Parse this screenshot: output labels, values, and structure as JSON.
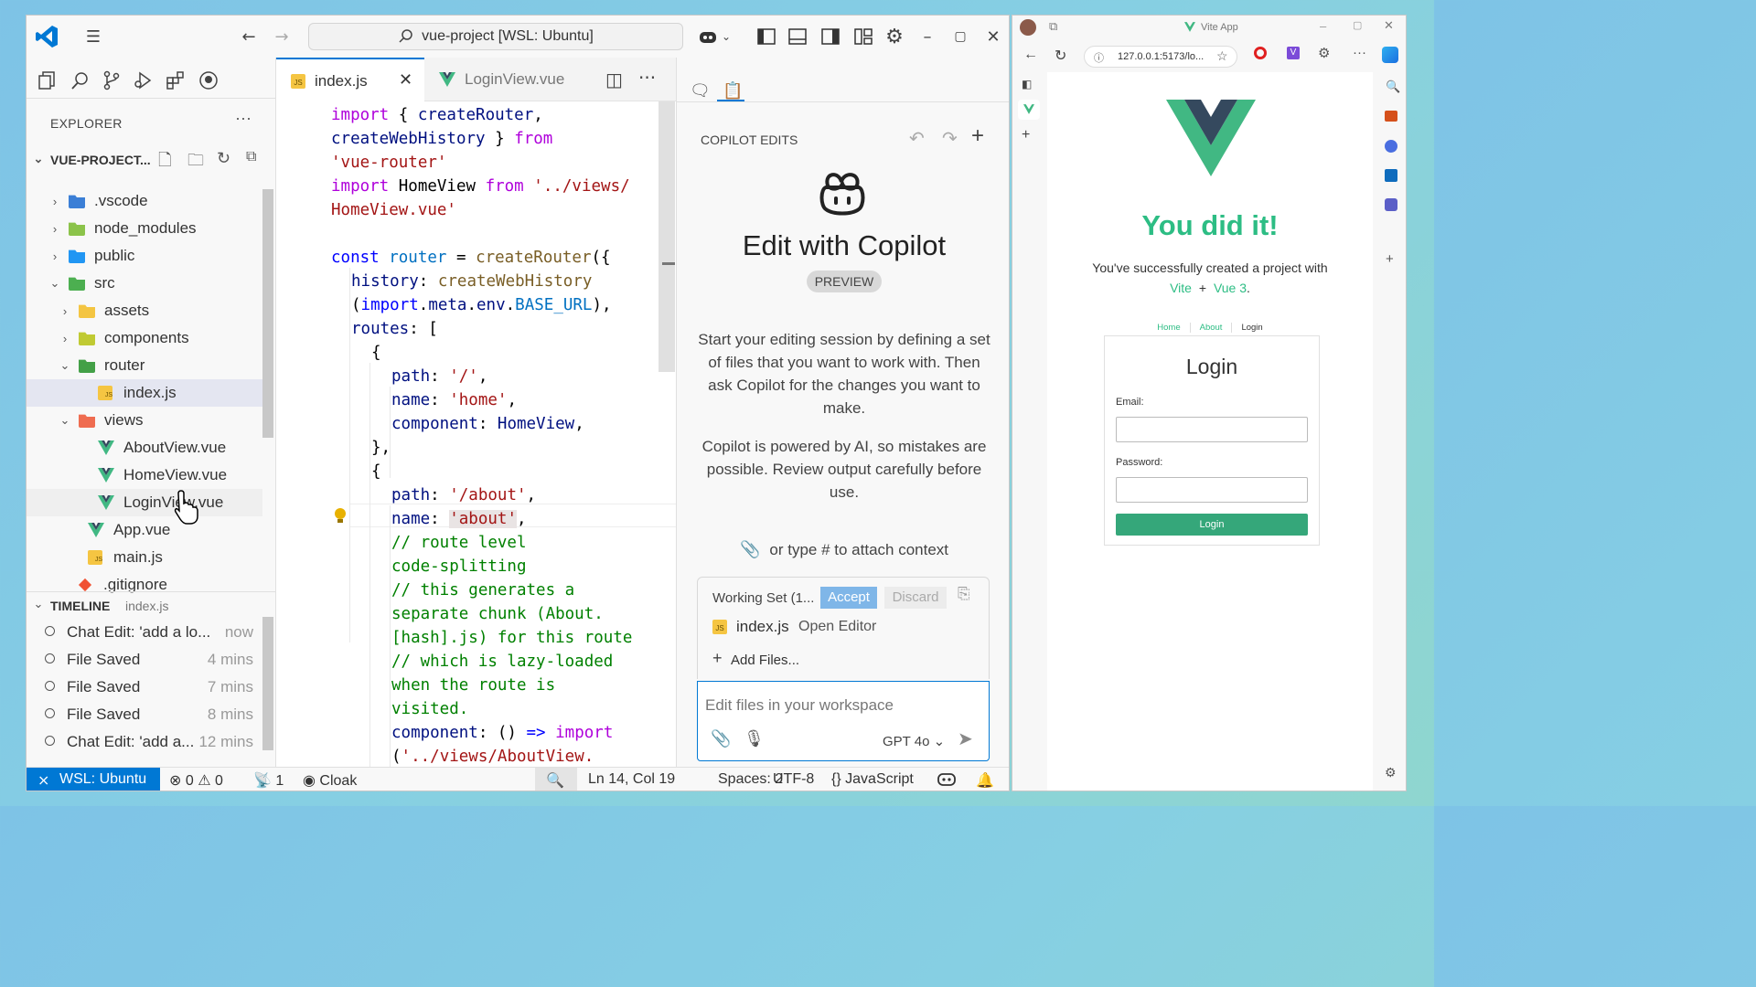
{
  "vscode": {
    "command_center": "vue-project [WSL: Ubuntu]",
    "explorer": {
      "header": "EXPLORER",
      "project": "VUE-PROJECT...",
      "items": [
        {
          "label": ".vscode",
          "indent": 0,
          "type": "folder",
          "chev": "›",
          "color": "#3b7fd6"
        },
        {
          "label": "node_modules",
          "indent": 0,
          "type": "folder",
          "chev": "›",
          "color": "#8bc34a"
        },
        {
          "label": "public",
          "indent": 0,
          "type": "folder",
          "chev": "›",
          "color": "#2196f3"
        },
        {
          "label": "src",
          "indent": 0,
          "type": "folder",
          "chev": "⌄",
          "color": "#4caf50"
        },
        {
          "label": "assets",
          "indent": 1,
          "type": "folder",
          "chev": "›",
          "color": "#f4c542"
        },
        {
          "label": "components",
          "indent": 1,
          "type": "folder",
          "chev": "›",
          "color": "#c0ca33"
        },
        {
          "label": "router",
          "indent": 1,
          "type": "folder",
          "chev": "⌄",
          "color": "#43a047"
        },
        {
          "label": "index.js",
          "indent": 2,
          "type": "js",
          "chev": "",
          "color": "#f5c542"
        },
        {
          "label": "views",
          "indent": 1,
          "type": "folder",
          "chev": "⌄",
          "color": "#ef6c50"
        },
        {
          "label": "AboutView.vue",
          "indent": 2,
          "type": "vue",
          "chev": "",
          "color": "#41b883"
        },
        {
          "label": "HomeView.vue",
          "indent": 2,
          "type": "vue",
          "chev": "",
          "color": "#41b883"
        },
        {
          "label": "LoginView.vue",
          "indent": 2,
          "type": "vue",
          "chev": "",
          "color": "#41b883"
        },
        {
          "label": "App.vue",
          "indent": 1,
          "type": "vue",
          "chev": "",
          "color": "#41b883"
        },
        {
          "label": "main.js",
          "indent": 1,
          "type": "js",
          "chev": "",
          "color": "#f5c542"
        },
        {
          "label": ".gitignore",
          "indent": 0,
          "type": "git",
          "chev": "",
          "color": "#f05133"
        }
      ]
    },
    "timeline": {
      "header": "TIMELINE",
      "file": "index.js",
      "items": [
        {
          "label": "Chat Edit: 'add a lo...",
          "time": "now"
        },
        {
          "label": "File Saved",
          "time": "4 mins"
        },
        {
          "label": "File Saved",
          "time": "7 mins"
        },
        {
          "label": "File Saved",
          "time": "8 mins"
        },
        {
          "label": "Chat Edit: 'add a...",
          "time": "12 mins"
        }
      ]
    },
    "tabs": [
      {
        "label": "index.js",
        "active": true
      },
      {
        "label": "LoginView.vue",
        "active": false
      }
    ],
    "copilot": {
      "header": "COPILOT EDITS",
      "title": "Edit with Copilot",
      "badge": "PREVIEW",
      "desc1": "Start your editing session by defining a set of files that you want to work with. Then ask Copilot for the changes you want to make.",
      "desc2": "Copilot is powered by AI, so mistakes are possible. Review output carefully before use.",
      "attach_hint": "or type # to attach context",
      "working_set": "Working Set (1...",
      "accept": "Accept",
      "discard": "Discard",
      "ws_file": "index.js",
      "ws_file_desc": "Open Editor",
      "add_files": "Add Files...",
      "input_placeholder": "Edit files in your workspace",
      "model": "GPT 4o"
    },
    "status": {
      "remote": "WSL: Ubuntu",
      "errors": "0",
      "warnings": "0",
      "ports": "1",
      "cloak": "Cloak",
      "position": "Ln 14, Col 19",
      "spaces": "Spaces: 2",
      "encoding": "UTF-8",
      "language": "JavaScript"
    }
  },
  "browser": {
    "tab_title": "Vite App",
    "url": "127.0.0.1:5173/lo...",
    "headline": "You did it!",
    "sub1": "You've successfully created a project with",
    "link_vite": "Vite",
    "plus": "+",
    "link_vue": "Vue 3",
    "period": ".",
    "nav": [
      "Home",
      "About",
      "Login"
    ],
    "login_title": "Login",
    "email_label": "Email:",
    "password_label": "Password:",
    "login_button": "Login"
  }
}
